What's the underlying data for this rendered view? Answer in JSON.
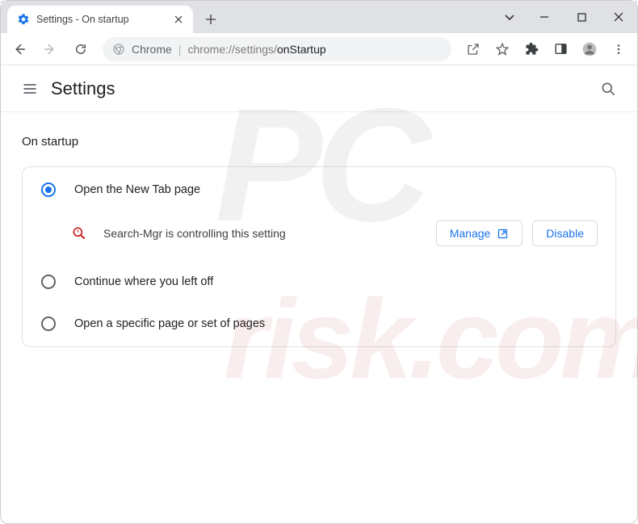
{
  "window": {
    "tab_title": "Settings - On startup"
  },
  "omnibox": {
    "chip": "Chrome",
    "url_prefix": "chrome://settings/",
    "url_path": "onStartup"
  },
  "settings": {
    "title": "Settings",
    "section_title": "On startup",
    "options": [
      {
        "label": "Open the New Tab page",
        "selected": true
      },
      {
        "label": "Continue where you left off",
        "selected": false
      },
      {
        "label": "Open a specific page or set of pages",
        "selected": false
      }
    ],
    "extension_notice": "Search-Mgr is controlling this setting",
    "manage_label": "Manage",
    "disable_label": "Disable"
  },
  "colors": {
    "accent": "#1a73e8"
  }
}
